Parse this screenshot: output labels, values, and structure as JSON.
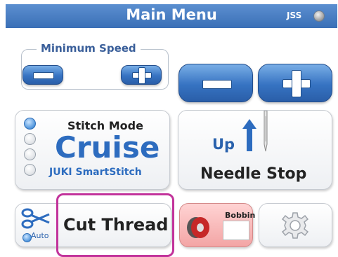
{
  "header": {
    "title": "Main Menu",
    "jss_label": "JSS"
  },
  "min_speed": {
    "label": "Minimum Speed"
  },
  "stitch_mode": {
    "label": "Stitch Mode",
    "value": "Cruise",
    "option": "JUKI SmartStitch"
  },
  "needle": {
    "direction": "Up",
    "label": "Needle Stop"
  },
  "cut_thread": {
    "label": "Cut Thread",
    "auto_label": "Auto"
  },
  "bobbin": {
    "label": "Bobbin"
  },
  "colors": {
    "header": "#3a6fb6",
    "accent_blue": "#2d6cbf",
    "highlight": "#c2339b",
    "bobbin_bg": "#f3a5a5"
  },
  "icons": [
    "minus-icon",
    "plus-icon",
    "radio-icon",
    "up-arrow-icon",
    "needle-icon",
    "scissors-icon",
    "bobbin-icon",
    "gear-icon"
  ]
}
